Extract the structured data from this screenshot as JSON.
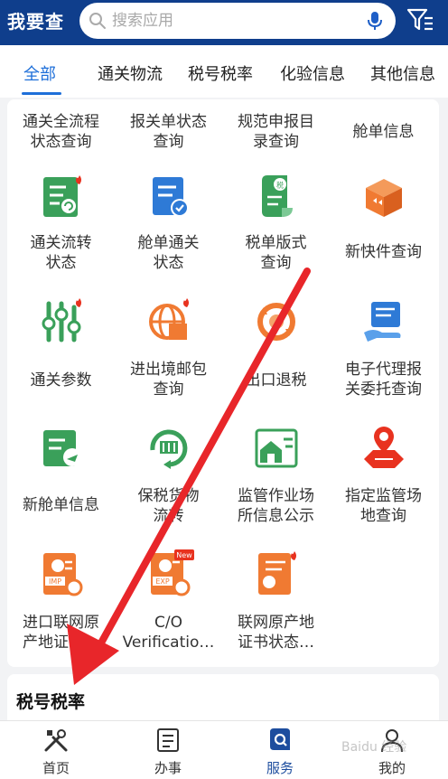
{
  "header": {
    "title": "我要查",
    "search_placeholder": "搜索应用"
  },
  "tabs": [
    {
      "label": "全部",
      "active": true
    },
    {
      "label": "通关物流"
    },
    {
      "label": "税号税率"
    },
    {
      "label": "化验信息"
    },
    {
      "label": "其他信息"
    }
  ],
  "grid": {
    "row0": [
      "通关全流程\n状态查询",
      "报关单状态\n查询",
      "规范申报目\n录查询",
      "舱单信息"
    ],
    "row1": [
      {
        "label": "通关流转\n状态",
        "icon": "customs-flow-icon"
      },
      {
        "label": "舱单通关\n状态",
        "icon": "manifest-status-icon"
      },
      {
        "label": "税单版式\n查询",
        "icon": "tax-form-icon"
      },
      {
        "label": "新快件查询",
        "icon": "package-icon"
      }
    ],
    "row2": [
      {
        "label": "通关参数",
        "icon": "settings-sliders-icon"
      },
      {
        "label": "进出境邮包\n查询",
        "icon": "globe-mail-icon"
      },
      {
        "label": "出口退税",
        "icon": "refund-cycle-icon"
      },
      {
        "label": "电子代理报\n关委托查询",
        "icon": "hand-document-icon"
      }
    ],
    "row3": [
      {
        "label": "新舱单信息",
        "icon": "flight-document-icon"
      },
      {
        "label": "保税货物\n流转",
        "icon": "bonded-cycle-icon"
      },
      {
        "label": "监管作业场\n所信息公示",
        "icon": "warehouse-icon"
      },
      {
        "label": "指定监管场\n地查询",
        "icon": "map-pin-icon"
      }
    ],
    "row4": [
      {
        "label": "进口联网原\n产地证明…",
        "icon": "certificate-imp-icon"
      },
      {
        "label": "C/O\nVerificatio…",
        "icon": "certificate-exp-icon"
      },
      {
        "label": "联网原产地\n证书状态…",
        "icon": "certificate-status-icon"
      }
    ],
    "badges": {
      "hot": "hot",
      "new": "New",
      "imp": "IMP",
      "exp": "EXP"
    }
  },
  "section2": {
    "title": "税号税率"
  },
  "bottom_nav": [
    {
      "label": "首页",
      "icon": "home-tools-icon"
    },
    {
      "label": "办事",
      "icon": "checklist-icon"
    },
    {
      "label": "服务",
      "icon": "service-search-icon",
      "active": true
    },
    {
      "label": "我的",
      "icon": "user-icon"
    }
  ],
  "watermark": "Baidu 经验",
  "colors": {
    "header_bg": "#0f3e8c",
    "accent": "#1e6fd9",
    "green_icon": "#3aa05a",
    "blue_icon": "#2e7ad6",
    "orange_icon": "#f07a32",
    "hot_red": "#e8321f",
    "arrow_red": "#e8262a"
  }
}
